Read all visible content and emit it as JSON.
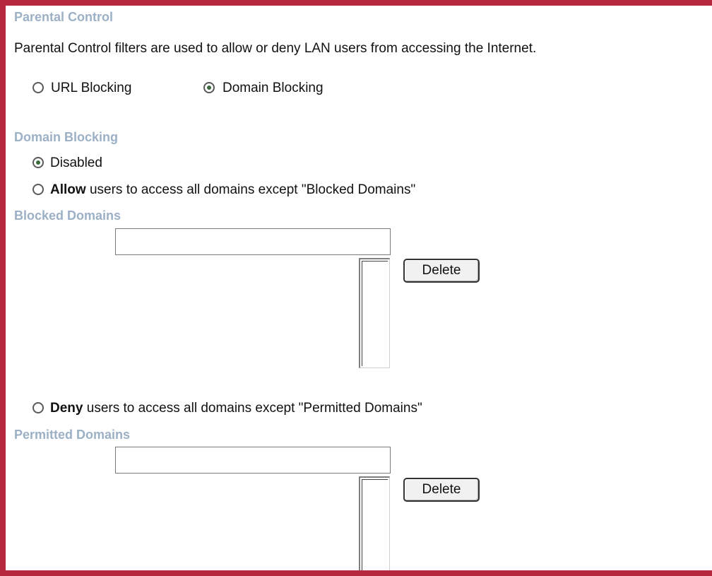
{
  "header": {
    "title": "Parental Control",
    "description": "Parental Control filters are used to allow or deny LAN users from accessing the Internet."
  },
  "mode": {
    "url_blocking_label": "URL Blocking",
    "domain_blocking_label": "Domain Blocking",
    "selected": "Domain Blocking"
  },
  "domain_blocking": {
    "heading": "Domain Blocking",
    "disabled_label": "Disabled",
    "allow_bold": "Allow",
    "allow_rest": " users to access all domains except \"Blocked Domains\"",
    "deny_bold": "Deny",
    "deny_rest": " users to access all domains except \"Permitted Domains\"",
    "selected": "Disabled"
  },
  "blocked_domains": {
    "heading": "Blocked Domains",
    "input_value": "",
    "delete_label": "Delete"
  },
  "permitted_domains": {
    "heading": "Permitted Domains",
    "input_value": "",
    "delete_label": "Delete"
  },
  "colors": {
    "frame_border": "#b5283d",
    "heading": "#9cb0c6"
  }
}
